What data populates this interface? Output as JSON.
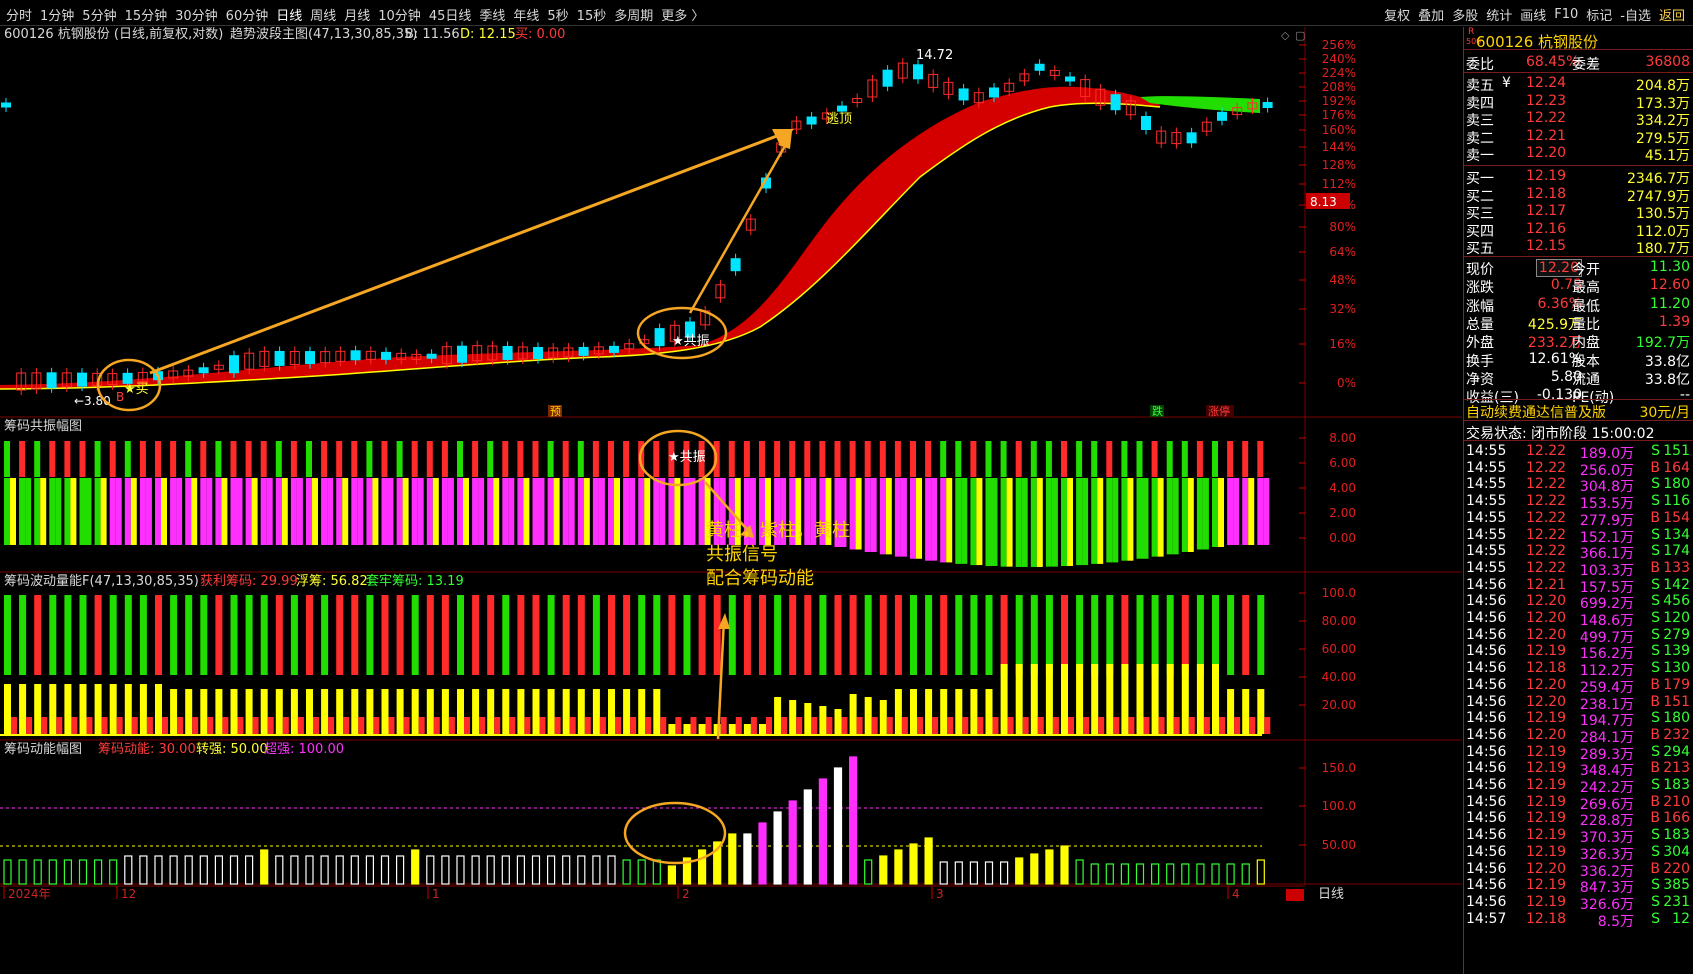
{
  "toolbar": {
    "left": [
      "分时",
      "1分钟",
      "5分钟",
      "15分钟",
      "30分钟",
      "60分钟",
      "日线",
      "周线",
      "月线",
      "10分钟",
      "45日线",
      "季线",
      "年线",
      "5秒",
      "15秒",
      "多周期",
      "更多 〉"
    ],
    "active": "日线",
    "right": [
      "复权",
      "叠加",
      "多股",
      "统计",
      "画线",
      "F10",
      "标记",
      "-自选",
      "返回"
    ]
  },
  "main": {
    "stock_title": "600126 杭钢股份 (日线,前复权,对数)",
    "indicator": "趋势波段主图(47,13,30,85,35)",
    "b_label": "B: 11.56",
    "d_label": "D: 12.15",
    "sell_label": "买: 0.00",
    "axis_pct": [
      "256%",
      "240%",
      "224%",
      "208%",
      "192%",
      "176%",
      "160%",
      "144%",
      "128%",
      "112%",
      "96%",
      "80%",
      "64%",
      "48%",
      "32%",
      "16%",
      "0%"
    ],
    "price_marker": "8.13",
    "peak_label": "14.72",
    "low_label": "←3.80",
    "escape_label": "逃顶",
    "resonance_label": "★共振",
    "buy_label": "★买",
    "b_tag": "B",
    "pre_tag": "预",
    "die_tag": "跌",
    "zhangting_tag": "涨停"
  },
  "panel1": {
    "title": "筹码共振幅图",
    "axis": [
      "8.00",
      "6.00",
      "4.00",
      "2.00",
      "0.00"
    ],
    "resonance_label": "★共振",
    "annotation": [
      "黄柱，紫柱，黄柱",
      "共振信号",
      "配合筹码动能"
    ]
  },
  "panel2": {
    "title": "筹码波动量能F(47,13,30,85,35)",
    "l1": "获利筹码: 29.99",
    "l2": "浮筹: 56.82",
    "l3": "套牢筹码: 13.19",
    "axis": [
      "100.0",
      "80.00",
      "60.00",
      "40.00",
      "20.00"
    ]
  },
  "panel3": {
    "title": "筹码动能幅图",
    "l1": "筹码动能: 30.00",
    "l2": "转强: 50.00",
    "l3": "超强: 100.00",
    "axis": [
      "150.0",
      "100.0",
      "50.00"
    ]
  },
  "date_axis": {
    "labels": [
      "2024年",
      "12",
      "1",
      "2",
      "3",
      "4"
    ],
    "period": "日线"
  },
  "colors": {
    "up": "#ff2b2b",
    "down": "#00e5ff",
    "yellow": "#ffff00",
    "magenta": "#ff30ff",
    "green": "#22dd00",
    "orange": "#f5a623",
    "axis_red": "#cc0000"
  },
  "quote": {
    "code_name": "600126 杭钢股份",
    "r_badge": "R",
    "r_sub": "500",
    "weibi_label": "委比",
    "weibi": "68.45%",
    "weicha_label": "委差",
    "weicha": "36808",
    "asks": [
      {
        "l": "卖五",
        "y": "¥",
        "p": "12.24",
        "v": "204.8万"
      },
      {
        "l": "卖四",
        "p": "12.23",
        "v": "173.3万"
      },
      {
        "l": "卖三",
        "p": "12.22",
        "v": "334.2万"
      },
      {
        "l": "卖二",
        "p": "12.21",
        "v": "279.5万"
      },
      {
        "l": "卖一",
        "p": "12.20",
        "v": "45.1万"
      }
    ],
    "bids": [
      {
        "l": "买一",
        "p": "12.19",
        "v": "2346.7万"
      },
      {
        "l": "买二",
        "p": "12.18",
        "v": "2747.9万"
      },
      {
        "l": "买三",
        "p": "12.17",
        "v": "130.5万"
      },
      {
        "l": "买四",
        "p": "12.16",
        "v": "112.0万"
      },
      {
        "l": "买五",
        "p": "12.15",
        "v": "180.7万"
      }
    ],
    "stats": [
      [
        {
          "t": "现价",
          "c": "#fff"
        },
        {
          "t": "12.20",
          "c": "#ff3b3b",
          "box": 1
        },
        {
          "t": "今开",
          "c": "#fff"
        },
        {
          "t": "11.30",
          "c": "#33ff33"
        }
      ],
      [
        {
          "t": "涨跌",
          "c": "#fff"
        },
        {
          "t": "0.73",
          "c": "#ff3b3b"
        },
        {
          "t": "最高",
          "c": "#fff"
        },
        {
          "t": "12.60",
          "c": "#ff3b3b"
        }
      ],
      [
        {
          "t": "涨幅",
          "c": "#fff"
        },
        {
          "t": "6.36%",
          "c": "#ff3b3b"
        },
        {
          "t": "最低",
          "c": "#fff"
        },
        {
          "t": "11.20",
          "c": "#33ff33"
        }
      ],
      [
        {
          "t": "总量",
          "c": "#fff"
        },
        {
          "t": "425.9万",
          "c": "#ffff33"
        },
        {
          "t": "量比",
          "c": "#fff"
        },
        {
          "t": "1.39",
          "c": "#ff3b3b"
        }
      ],
      [
        {
          "t": "外盘",
          "c": "#fff"
        },
        {
          "t": "233.2万",
          "c": "#ff3b3b"
        },
        {
          "t": "内盘",
          "c": "#fff"
        },
        {
          "t": "192.7万",
          "c": "#33ff33"
        }
      ],
      [
        {
          "t": "换手",
          "c": "#fff"
        },
        {
          "t": "12.61%",
          "c": "#fff"
        },
        {
          "t": "股本",
          "c": "#fff"
        },
        {
          "t": "33.8亿",
          "c": "#fff"
        }
      ],
      [
        {
          "t": "净资",
          "c": "#fff"
        },
        {
          "t": "5.80",
          "c": "#fff"
        },
        {
          "t": "流通",
          "c": "#fff"
        },
        {
          "t": "33.8亿",
          "c": "#fff"
        }
      ],
      [
        {
          "t": "收益(三)",
          "c": "#fff"
        },
        {
          "t": "-0.130",
          "c": "#fff"
        },
        {
          "t": "PE(动)",
          "c": "#fff"
        },
        {
          "t": "--",
          "c": "#fff"
        }
      ]
    ],
    "ad_text": "自动续费通达信普及版",
    "ad_price": "30元/月",
    "status": "交易状态: 闭市阶段 15:00:02",
    "ticks": [
      {
        "t": "14:55",
        "p": "12.22",
        "v": "189.0万",
        "s": "S",
        "n": "151"
      },
      {
        "t": "14:55",
        "p": "12.22",
        "v": "256.0万",
        "s": "B",
        "n": "164"
      },
      {
        "t": "14:55",
        "p": "12.22",
        "v": "304.8万",
        "s": "S",
        "n": "180"
      },
      {
        "t": "14:55",
        "p": "12.22",
        "v": "153.5万",
        "s": "S",
        "n": "116"
      },
      {
        "t": "14:55",
        "p": "12.22",
        "v": "277.9万",
        "s": "B",
        "n": "154"
      },
      {
        "t": "14:55",
        "p": "12.22",
        "v": "152.1万",
        "s": "S",
        "n": "134"
      },
      {
        "t": "14:55",
        "p": "12.22",
        "v": "366.1万",
        "s": "S",
        "n": "174"
      },
      {
        "t": "14:55",
        "p": "12.22",
        "v": "103.3万",
        "s": "B",
        "n": "133"
      },
      {
        "t": "14:56",
        "p": "12.21",
        "v": "157.5万",
        "s": "S",
        "n": "142"
      },
      {
        "t": "14:56",
        "p": "12.20",
        "v": "699.2万",
        "s": "S",
        "n": "456"
      },
      {
        "t": "14:56",
        "p": "12.20",
        "v": "148.6万",
        "s": "S",
        "n": "120"
      },
      {
        "t": "14:56",
        "p": "12.20",
        "v": "499.7万",
        "s": "S",
        "n": "279"
      },
      {
        "t": "14:56",
        "p": "12.19",
        "v": "156.2万",
        "s": "S",
        "n": "139"
      },
      {
        "t": "14:56",
        "p": "12.18",
        "v": "112.2万",
        "s": "S",
        "n": "130"
      },
      {
        "t": "14:56",
        "p": "12.20",
        "v": "259.4万",
        "s": "B",
        "n": "179"
      },
      {
        "t": "14:56",
        "p": "12.20",
        "v": "238.1万",
        "s": "B",
        "n": "151"
      },
      {
        "t": "14:56",
        "p": "12.19",
        "v": "194.7万",
        "s": "S",
        "n": "180"
      },
      {
        "t": "14:56",
        "p": "12.20",
        "v": "284.1万",
        "s": "B",
        "n": "232"
      },
      {
        "t": "14:56",
        "p": "12.19",
        "v": "289.3万",
        "s": "S",
        "n": "294"
      },
      {
        "t": "14:56",
        "p": "12.19",
        "v": "348.4万",
        "s": "B",
        "n": "213"
      },
      {
        "t": "14:56",
        "p": "12.19",
        "v": "242.2万",
        "s": "S",
        "n": "183"
      },
      {
        "t": "14:56",
        "p": "12.19",
        "v": "269.6万",
        "s": "B",
        "n": "210"
      },
      {
        "t": "14:56",
        "p": "12.19",
        "v": "228.8万",
        "s": "B",
        "n": "166"
      },
      {
        "t": "14:56",
        "p": "12.19",
        "v": "370.3万",
        "s": "S",
        "n": "183"
      },
      {
        "t": "14:56",
        "p": "12.19",
        "v": "326.3万",
        "s": "S",
        "n": "304"
      },
      {
        "t": "14:56",
        "p": "12.20",
        "v": "336.2万",
        "s": "B",
        "n": "220"
      },
      {
        "t": "14:56",
        "p": "12.19",
        "v": "847.3万",
        "s": "S",
        "n": "385"
      },
      {
        "t": "14:56",
        "p": "12.19",
        "v": "326.6万",
        "s": "S",
        "n": "231"
      },
      {
        "t": "14:57",
        "p": "12.18",
        "v": "8.5万",
        "s": "S",
        "n": "12"
      }
    ]
  }
}
